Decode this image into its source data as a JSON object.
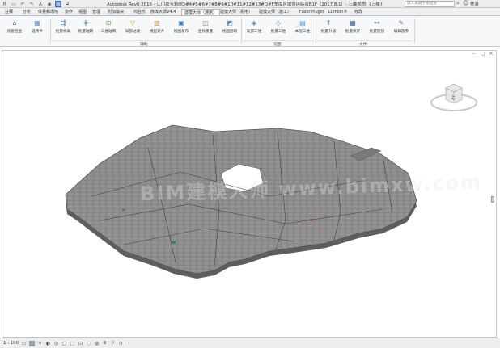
{
  "window": {
    "title": "Autodesk Revit 2016 -   江门嘉宝莉园3#4#5#6#7#8#9#10#11#12#13#Q#F车库区域暨运综合B1F（2017.8.1）- 三维视图: {三维}",
    "search_placeholder": "键入关键字或短语",
    "user_label": "登录"
  },
  "quick_access": [
    "R",
    "▭",
    "↶",
    "↷",
    "A",
    "◉",
    "▤",
    "⧉"
  ],
  "tabs": [
    {
      "label": "注释"
    },
    {
      "label": "分析"
    },
    {
      "label": "体量和场地"
    },
    {
      "label": "协作"
    },
    {
      "label": "视图"
    },
    {
      "label": "管理"
    },
    {
      "label": "附加模块"
    },
    {
      "label": "鸿业乐"
    },
    {
      "label": "族库大师V4.4"
    },
    {
      "label": "建模大师（通用）",
      "active": true
    },
    {
      "label": "建模大师（机电）"
    },
    {
      "label": "建模大师（施工）"
    },
    {
      "label": "Fuzor Plugin"
    },
    {
      "label": "Lumion®"
    },
    {
      "label": "修改"
    }
  ],
  "ribbon": {
    "buttons": [
      {
        "label": "房屋检查",
        "icon": "house-check-icon",
        "color": "#3a78c2",
        "glyph": "⌂"
      },
      {
        "label": "选项卡",
        "icon": "tab-options-icon",
        "color": "#5b8fc9",
        "glyph": "▦"
      },
      {
        "label": "批量标高",
        "icon": "batch-level-icon",
        "color": "#3a78c2",
        "glyph": "⇶"
      },
      {
        "label": "批量轴网",
        "icon": "batch-grid-icon",
        "color": "#4c9ad0",
        "glyph": "⋕"
      },
      {
        "label": "三维轴网",
        "icon": "3d-grid-icon",
        "color": "#6aa84f",
        "glyph": "⊞"
      },
      {
        "label": "局部过滤",
        "icon": "local-filter-icon",
        "color": "#e0a030",
        "glyph": "▽"
      },
      {
        "label": "模型对齐",
        "icon": "model-align-icon",
        "color": "#c2a040",
        "glyph": "▥"
      },
      {
        "label": "视图发布",
        "icon": "view-publish-icon",
        "color": "#3a78c2",
        "glyph": "▣"
      },
      {
        "label": "查找重叠",
        "icon": "find-overlap-icon",
        "color": "#8a8a8a",
        "glyph": "◫"
      },
      {
        "label": "视图剖切",
        "icon": "view-section-icon",
        "color": "#5b8fc9",
        "glyph": "◩"
      },
      {
        "label": "局部三维",
        "icon": "local-3d-icon",
        "color": "#3a78c2",
        "glyph": "◈"
      },
      {
        "label": "批量三维",
        "icon": "batch-3d-icon",
        "color": "#5b8fc9",
        "glyph": "◇"
      },
      {
        "label": "本层三维",
        "icon": "floor-3d-icon",
        "color": "#4c9ad0",
        "glyph": "▤"
      },
      {
        "label": "批量升级",
        "icon": "batch-upgrade-icon",
        "color": "#2e5fa8",
        "glyph": "⇑"
      },
      {
        "label": "批量保存",
        "icon": "batch-save-icon",
        "color": "#2e5fa8",
        "glyph": "▦"
      },
      {
        "label": "批量链接",
        "icon": "batch-link-icon",
        "color": "#2e5fa8",
        "glyph": "⚯"
      },
      {
        "label": "编辑族参",
        "icon": "edit-family-icon",
        "color": "#6a6fb0",
        "glyph": "✎"
      }
    ],
    "panels": [
      {
        "label": "辅助"
      },
      {
        "label": "视图"
      },
      {
        "label": "文件"
      }
    ]
  },
  "viewport": {
    "viewcube_face": "上",
    "watermark": "BIM建模大师 www.bimxw.com"
  },
  "statusbar": {
    "scale": "1 : 100"
  },
  "colors": {
    "accent": "#3c6fb4",
    "model_fill": "#8e8e8e",
    "model_edge": "#555555"
  }
}
